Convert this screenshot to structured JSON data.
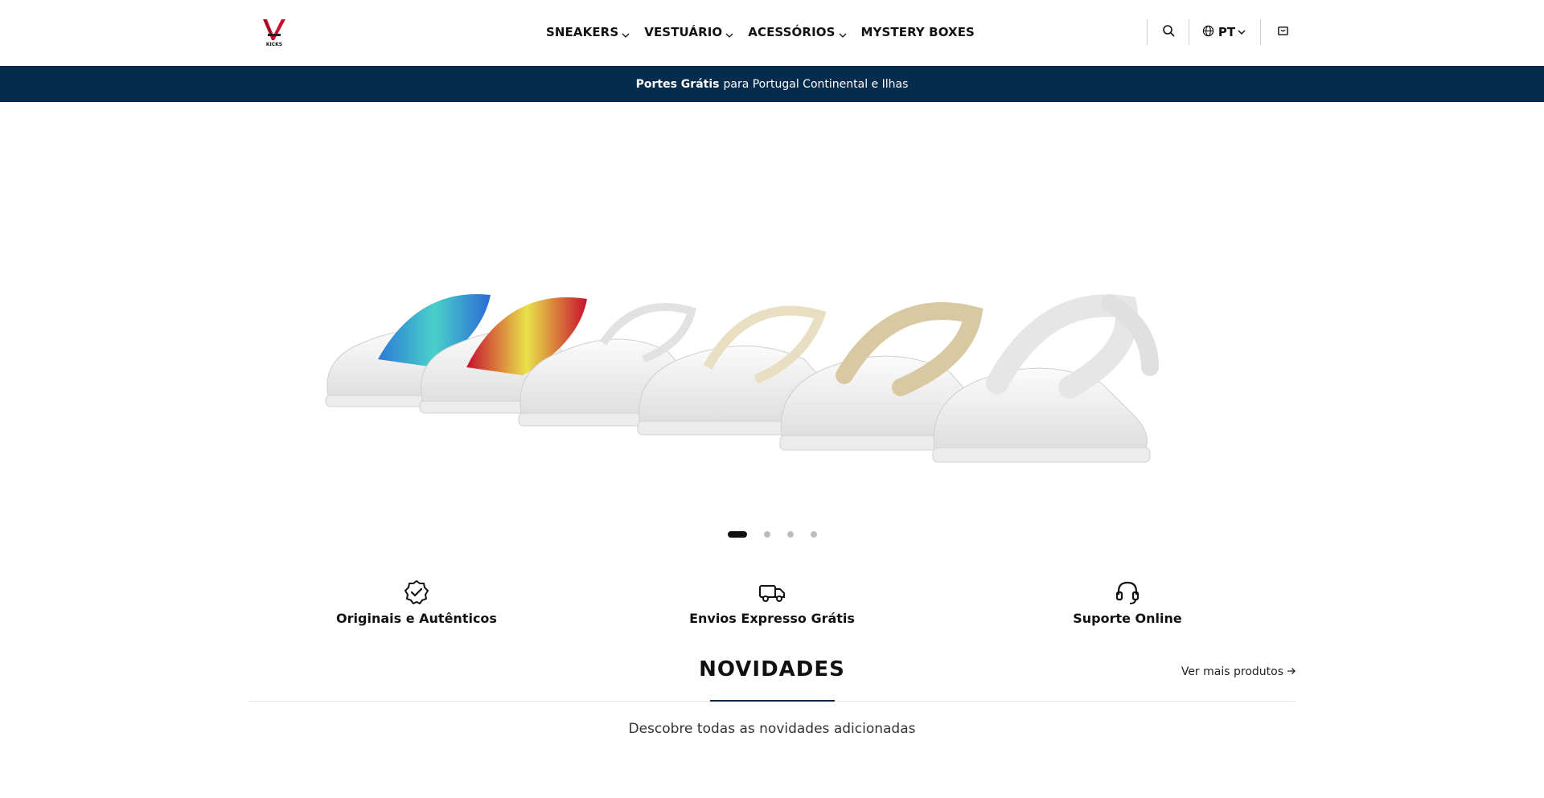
{
  "header": {
    "logo_text": "KICKS",
    "nav": [
      {
        "label": "SNEAKERS",
        "has_dropdown": true
      },
      {
        "label": "VESTUÁRIO",
        "has_dropdown": true
      },
      {
        "label": "ACESSÓRIOS",
        "has_dropdown": true
      },
      {
        "label": "MYSTERY BOXES",
        "has_dropdown": false
      }
    ],
    "language": "PT",
    "icons": [
      "search-icon",
      "globe-icon",
      "cart-icon"
    ]
  },
  "announcement": {
    "bold": "Portes Grátis",
    "text": "para Portugal Continental e Ilhas",
    "background": "#052b4d"
  },
  "hero": {
    "slide_count": 4,
    "active_slide": 1
  },
  "features": [
    {
      "icon": "verified-badge-icon",
      "label": "Originais e Autênticos"
    },
    {
      "icon": "truck-icon",
      "label": "Envios Expresso Grátis"
    },
    {
      "icon": "headset-icon",
      "label": "Suporte Online"
    }
  ],
  "section": {
    "title": "NOVIDADES",
    "see_more": "Ver mais produtos",
    "subtitle": "Descobre todas as novidades adicionadas"
  }
}
